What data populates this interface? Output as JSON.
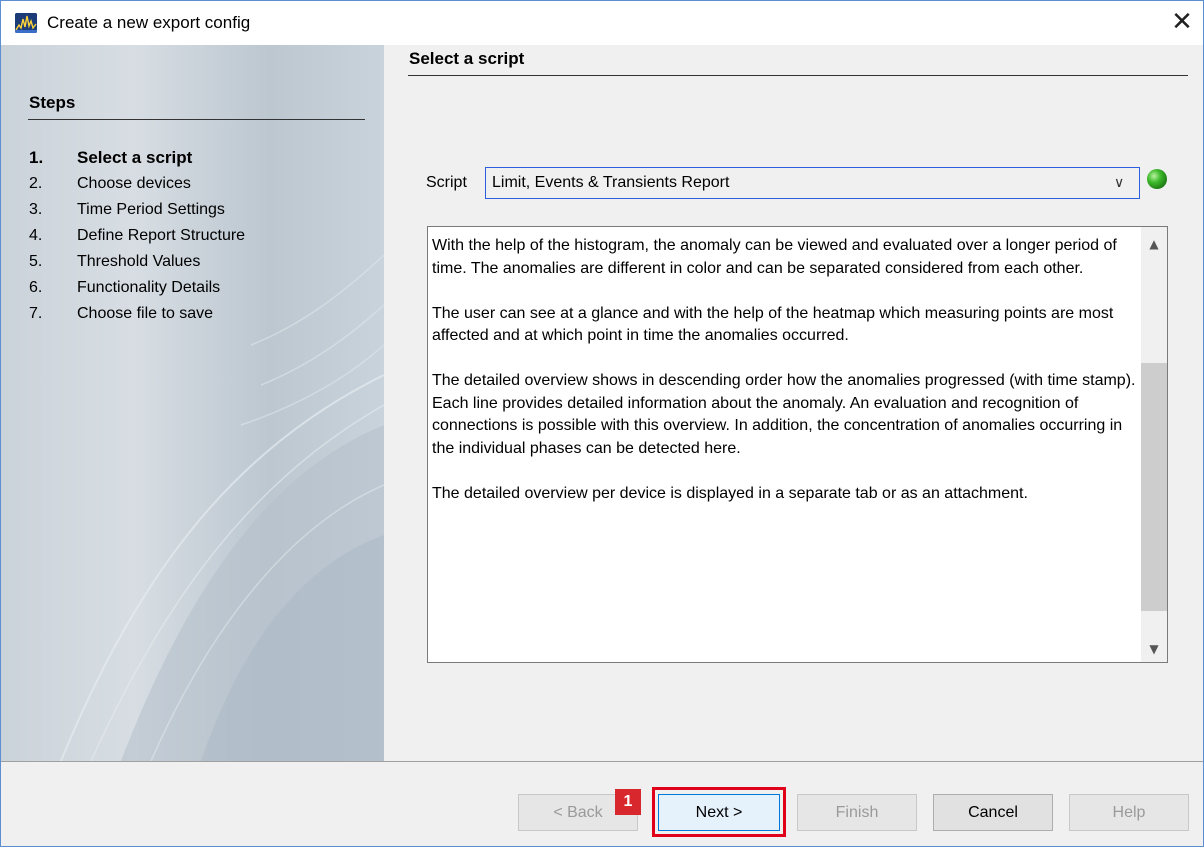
{
  "window": {
    "title": "Create a new export config",
    "close_glyph": "✕",
    "app_icon": "chart-app-icon"
  },
  "steps": {
    "heading": "Steps",
    "items": [
      {
        "num": "1.",
        "label": "Select a script",
        "current": true
      },
      {
        "num": "2.",
        "label": "Choose devices",
        "current": false
      },
      {
        "num": "3.",
        "label": "Time Period Settings",
        "current": false
      },
      {
        "num": "4.",
        "label": "Define Report Structure",
        "current": false
      },
      {
        "num": "5.",
        "label": "Threshold Values",
        "current": false
      },
      {
        "num": "6.",
        "label": "Functionality Details",
        "current": false
      },
      {
        "num": "7.",
        "label": "Choose file to save",
        "current": false
      }
    ]
  },
  "content": {
    "heading": "Select a script",
    "script_label": "Script",
    "script_value": "Limit, Events & Transients Report",
    "status": "green",
    "description": [
      "With the help of the histogram, the anomaly can be viewed and evaluated over a longer period of time. The anomalies are different in color and can be separated considered from each other.",
      "The user can see at a glance and with the help of the heatmap which measuring points are most affected and at which point in time the anomalies occurred.",
      "The detailed overview shows in descending order how the anomalies progressed (with time stamp). Each line provides detailed information about the anomaly. An evaluation and recognition of connections is possible with this overview. In addition, the concentration of anomalies occurring in the individual phases can be detected here.",
      "The detailed overview per device is displayed in a separate tab or as an attachment."
    ]
  },
  "buttons": {
    "back": "< Back",
    "next": "Next >",
    "finish": "Finish",
    "cancel": "Cancel",
    "help": "Help"
  },
  "annotation": {
    "badge": "1",
    "highlight_color": "#e0001a"
  },
  "colors": {
    "accent": "#0078d7",
    "select_border": "#2b5fe0",
    "badge_bg": "#d9272e"
  }
}
